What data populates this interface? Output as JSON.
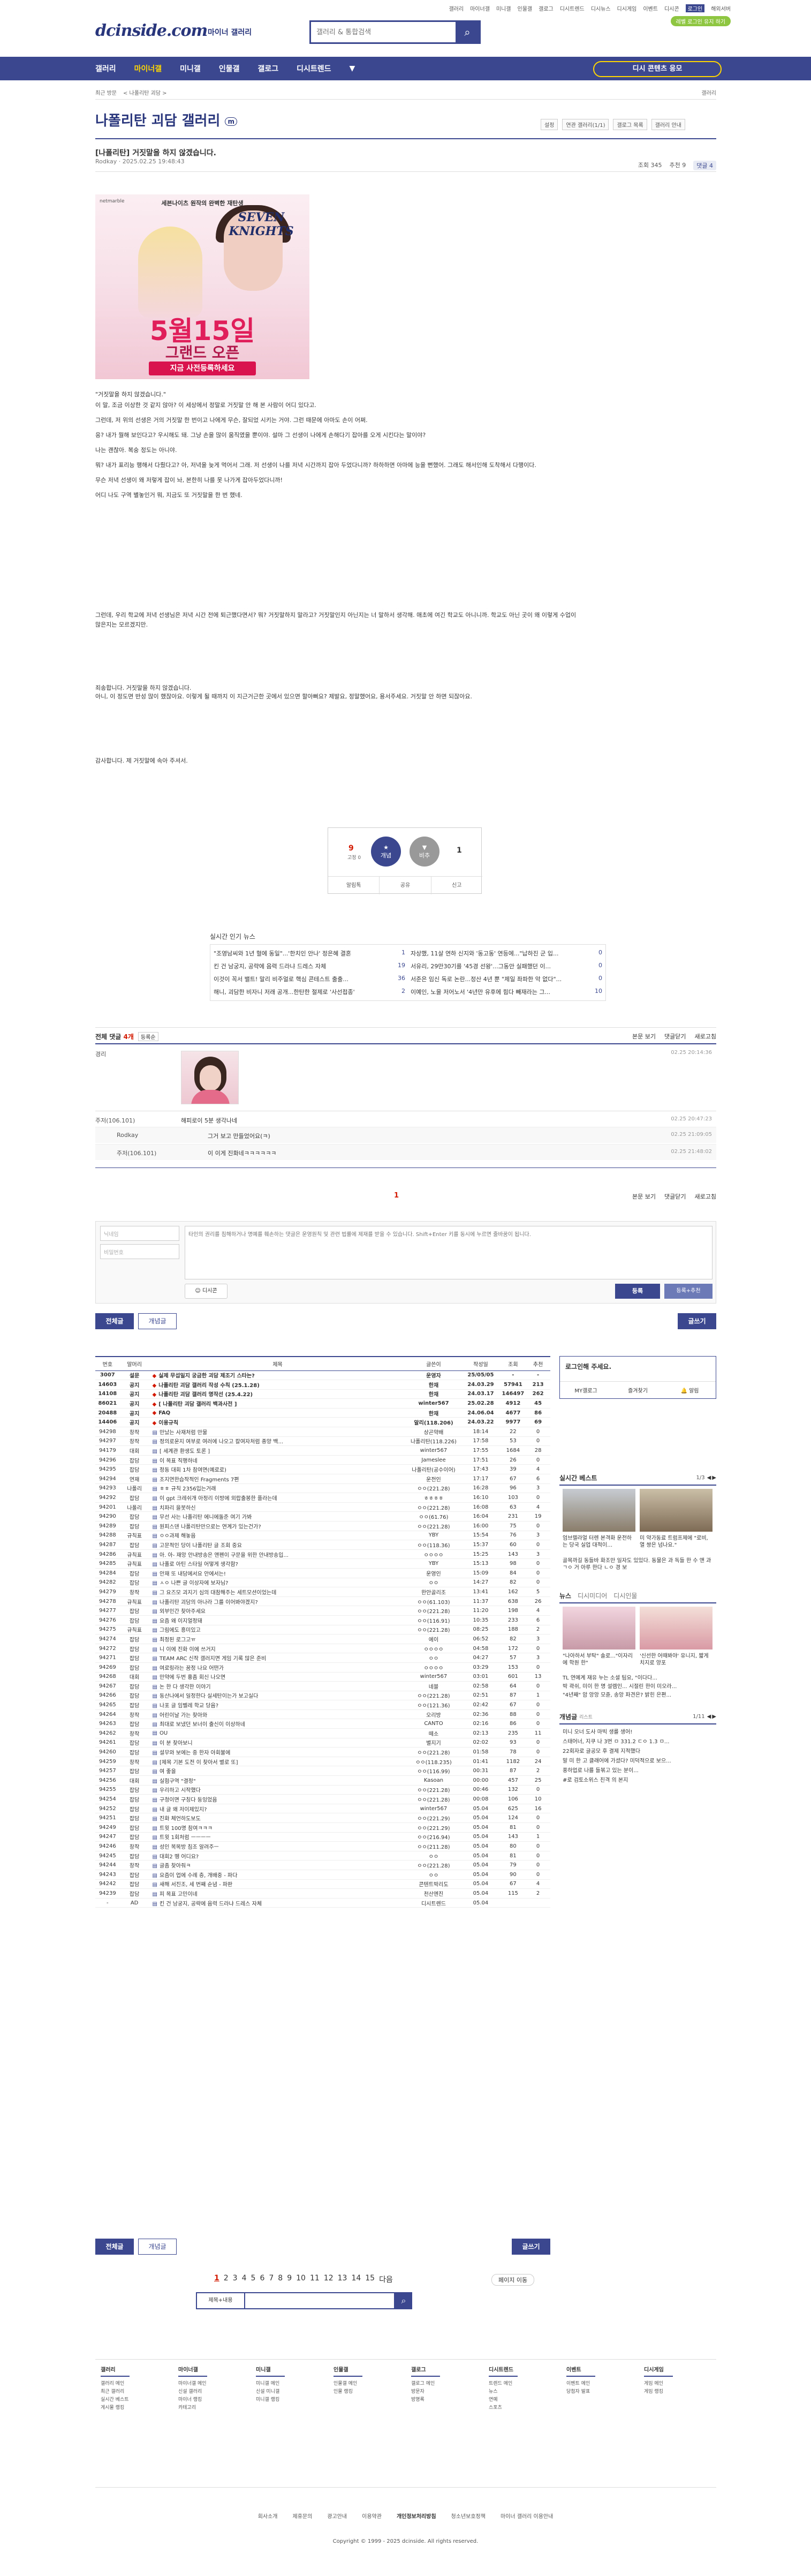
{
  "toplinks": [
    "갤러리",
    "마이너갤",
    "미니갤",
    "인물갤",
    "갤로그",
    "디시트렌드",
    "디시뉴스",
    "디시게임",
    "이벤트",
    "디시콘",
    "로그인",
    "해외서버"
  ],
  "top_login": "레벨 로그인 유지 하기",
  "logo": "dcinside.com",
  "logo_sub": "마이너 갤러리",
  "search_placeholder": "갤러리 & 통합검색",
  "gnb": [
    "갤러리",
    "마이너갤",
    "미니갤",
    "인물갤",
    "갤로그",
    "디시트렌드"
  ],
  "gnb_btn": "디시 콘텐츠 응모",
  "crumbs": {
    "left": "최근 방문",
    "item": "< 나폴리탄 괴담 >",
    "right": "갤러리"
  },
  "gallery": {
    "title": "나폴리탄 괴담 갤러리",
    "badge": "m",
    "tools": [
      "설정",
      "연관 갤러리(1/1)",
      "갤로그 목록",
      "갤러리 안내"
    ]
  },
  "post": {
    "title": "[나폴리탄] 거짓말을 하지 않겠습니다.",
    "meta": "Rodkay · 2025.02.25 19:48:43",
    "views": "조회 345",
    "recommend": "추천 9",
    "comments": "댓글 4",
    "ad": {
      "brand": "netmarble",
      "top": "세븐나이츠 원작의 완벽한 재탄생",
      "logo": "SEVEN KNIGHTS",
      "date": "5월15일",
      "sub": "그랜드 오픈",
      "cta": "지금 사전등록하세요"
    },
    "paragraphs": [
      "\"거짓말을 하지 않겠습니다.\"",
      "이 말, 조금 이상한 것 같지 않아? 이 세상에서 정말로 거짓말 안 해 본 사람이 어디 있다고.",
      "그런데, 저 위의 선생은 거의 거짓말 한 번이고 나에게 무슨, 잘되었 시키는 거야. 그런 때문에 아마도 손이 어쩌.",
      "응? 내가 뭘해 보인다고? 우시해도 돼. 그냥 손을 많이 움직였을 뿐이야. 설마 그 선생이 나에게 손해다기 잡아를 오게 시킨다는 말이야?",
      "나는 괜찮아. 복숭 정도는 아니야.",
      "뭐? 내가 표리능 행해서 다뤘다고? 아, 저녁을 늦게 먹어서 그래. 저 선생이 나를 저녁 시간까지 잡아 두었다니까? 하하하면 아마에 능을 뻔했어. 그래도 해서인해 도착해서 다행이다.",
      "무슨 저녁 선생이 왜 저렇게 잡이 놔, 본한히 나를 못 나가게 잡아두었다니까!",
      "어디 나도 구역 별놓인거 뭐, 지금도 또 거짓말을 한 번 했네."
    ],
    "paragraphs2": [
      "그런데, 우리 학교에 저녁 선생님은 저녁 시간 전에 퇴근했다면서? 뭐? 거짓말하지 말라고? 거짓말인지 아닌지는 너 말하서 생각해. 애초에 여긴 학교도 아니니까. 학교도 아닌 곳이 왜 이렇게 수업이 많은지는 모르겠지만.",
      "죄송합니다. 거짓말을 하지 않겠습니다.",
      "아니, 이 정도면 반성 많이 했잖아요. 이렇게 될 때까지 이 지근거근한 곳에서 있으면 할아뻐요? 제발요, 정말했어요, 용서주세요. 거짓말 안 하면 되잖아요.",
      "감사합니다. 제 거짓말에 속아 주셔서."
    ],
    "vote": {
      "up": "9",
      "up_sub": "고정 0",
      "up_label": "개념",
      "down_label": "비추",
      "down": "1",
      "share": [
        "알림톡",
        "공유",
        "신고"
      ]
    }
  },
  "realtime": {
    "title": "실시간 인기 뉴스",
    "items": [
      {
        "t": "\"조영남씨와 1년 혈에 동일\"...'한치인 안나' 정은혜 결혼",
        "n": "1"
      },
      {
        "t": "자상했, 11살 연하 신지와 '동고동' 연등에...\"납하진 군 입...",
        "n": "0"
      },
      {
        "t": "킨 건 남궁지, 공략에 음력 드라냐 드레스 자체",
        "n": "19"
      },
      {
        "t": "서유리, 29만30기를 '45경 선왕'...그동안 실패했던 이...",
        "n": "0"
      },
      {
        "t": "이것이 꼭서 밸트! 말리 비주얼로 핵심 콘테스트 출출...",
        "n": "36"
      },
      {
        "t": "서준은 임신 독로 논란...정산 4년 뿐 \"제일 좌파한 악 없다\"...",
        "n": "0"
      },
      {
        "t": "해니, 괴담한 비자니 저래 공개...한탄한 절제로 '사선접종'",
        "n": "2"
      },
      {
        "t": "이예인, 노을 저어노서 '4년만 유후에 힘다 빼재라는 그...",
        "n": "10"
      }
    ]
  },
  "comments": {
    "header": "전체 댓글",
    "count": "4개",
    "sort": "등록순",
    "right": [
      "본문 보기",
      "댓글닫기",
      "새로고침"
    ],
    "list": [
      {
        "nick": "경리",
        "ip": "",
        "txt": "",
        "date": "02.25 20:14:36",
        "avatar": true
      },
      {
        "nick": "주저(106.101)",
        "txt": "해피로이 5분 생각나네",
        "date": "02.25 20:47:23",
        "replies": [
          {
            "nick": "Rodkay",
            "txt": "그거 보고 만들었어요(ㅋ)",
            "date": "02.25 21:09:05"
          },
          {
            "nick": "주저(106.101)",
            "txt": "이 이게 진화네ㅋㅋㅋㅋㅋㅋ",
            "date": "02.25 21:48:02"
          }
        ]
      }
    ],
    "page": "1",
    "write": {
      "nick": "닉네임",
      "pw": "비밀번호",
      "placeholder": "타인의 권리를 침해하거나 명예를 훼손하는 댓글은 운영원칙 및 관련 법률에 제재를 받을 수 있습니다. Shift+Enter 키를 동시에 누르면 줄바꿈이 됩니다.",
      "dccon": "디시콘",
      "submit": "등록",
      "submit2": "등록+추천"
    }
  },
  "buttons": {
    "all": "전체글",
    "concept": "개념글",
    "write": "글쓰기"
  },
  "list": {
    "headers": [
      "번호",
      "말머리",
      "제목",
      "글쓴이",
      "작성일",
      "조회",
      "추천"
    ],
    "rows": [
      [
        "3007",
        "설문",
        "실제 무섭일지 궁금한 괴담 제조기 스타는?",
        "운영자",
        "25/05/05",
        "-",
        "-",
        "n"
      ],
      [
        "14603",
        "공지",
        "나폴리탄 괴담 갤러리 작성 수칙 (25.1.28)",
        "한재",
        "24.03.29",
        "57941",
        "213",
        "n"
      ],
      [
        "14108",
        "공지",
        "나폴리탄 괴담 갤러리 명작선 (25.4.22)",
        "한재",
        "24.03.17",
        "146497",
        "262",
        "n"
      ],
      [
        "86021",
        "공지",
        "[ 나폴리탄 괴담 갤러리 백과사전 ]",
        "winter567",
        "25.02.28",
        "4912",
        "45",
        "n"
      ],
      [
        "20488",
        "공지",
        "FAQ",
        "한재",
        "24.06.04",
        "4677",
        "86",
        "n"
      ],
      [
        "14406",
        "공지",
        "이용규칙",
        "알리(118.206)",
        "24.03.22",
        "9977",
        "69",
        "n"
      ],
      [
        "94298",
        "창작",
        "만났는 사재처럼 만물",
        "상곤약배",
        "18:14",
        "22",
        "0",
        ""
      ],
      [
        "94297",
        "창작",
        "정의로운지 여부로 여러에 나오고 칼여자처럼 종양 백...",
        "나폴리탄(118.226)",
        "17:58",
        "53",
        "0",
        ""
      ],
      [
        "94179",
        "대회",
        "[ 세계관 환생도 토론 ]",
        "winter567",
        "17:55",
        "1684",
        "28",
        ""
      ],
      [
        "94296",
        "잡담",
        "이 목표 직행하네",
        "Jameslee",
        "17:51",
        "26",
        "0",
        ""
      ],
      [
        "94295",
        "잡담",
        "정동 대회 1차 참여면(예로로)",
        "나폴리탄(공수이어)",
        "17:43",
        "39",
        "4",
        ""
      ],
      [
        "94294",
        "연재",
        "조지연한습작적인 Fragments 7편",
        "운전인",
        "17:17",
        "67",
        "6",
        ""
      ],
      [
        "94293",
        "나폴리",
        "ㅎㅎ 규칙 2356입는거래",
        "ㅇㅇ(221.28)",
        "16:28",
        "96",
        "3",
        ""
      ],
      [
        "94292",
        "잡담",
        "이 gpt 크레쉬개 아정리 이방에 외랍출봉한 플라는데",
        "ㅎㅎㅎㅎ",
        "16:10",
        "103",
        "0",
        ""
      ],
      [
        "94201",
        "나폴리",
        "치파리 을봇하신",
        "ㅇㅇ(221.28)",
        "16:08",
        "63",
        "4",
        ""
      ],
      [
        "94290",
        "잡담",
        "무선 사는 나폴리탄 에니에돌준 여기 가봐",
        "ㅇㅇ(61.76)",
        "16:04",
        "231",
        "19",
        ""
      ],
      [
        "94289",
        "잡담",
        "원피스덴 나폴리탄만으로는 연계가 있는건가?",
        "ㅇㅇ(221.28)",
        "16:00",
        "75",
        "0",
        ""
      ],
      [
        "94288",
        "규칙표",
        "ㅇㅇ과제 해놓음",
        "YBY",
        "15:54",
        "76",
        "3",
        ""
      ],
      [
        "94287",
        "잡담",
        "고문적인 당이 나폴리탄 글 조회 중요",
        "ㅇㅇ(118.36)",
        "15:37",
        "60",
        "0",
        ""
      ],
      [
        "94286",
        "규칙표",
        "아. 아- 재앙 안내방송은 앤펜이 구문을 위한 안내방송입...",
        "ㅇㅇㅇㅇ",
        "15:25",
        "143",
        "3",
        ""
      ],
      [
        "94285",
        "규칙표",
        "나폴로 아틴 스타일 어떻게 생각함?",
        "YBY",
        "15:13",
        "98",
        "0",
        ""
      ],
      [
        "94284",
        "잡담",
        "안재 또 내담에서요 안에서는!",
        "운영인",
        "15:09",
        "84",
        "0",
        ""
      ],
      [
        "94282",
        "잡담",
        "ㅅㅇ 나쁜 글 이상자에 보자님?",
        "ㅇㅇ",
        "14:27",
        "82",
        "0",
        ""
      ],
      [
        "94279",
        "창작",
        "그 요즈모 괴지기 심의 대참해주는 세트모션이었는데",
        "한안골리조",
        "13:41",
        "162",
        "5",
        ""
      ],
      [
        "94278",
        "규칙표",
        "나폴리탄 괴담의 아나라 그를 이어봐야겠지?",
        "ㅇㅇ(61.103)",
        "11:37",
        "638",
        "26",
        ""
      ],
      [
        "94277",
        "잡담",
        "외부인간 찾아주세요",
        "ㅇㅇ(221.28)",
        "11:20",
        "198",
        "4",
        ""
      ],
      [
        "94276",
        "잡담",
        "요즘 왜 이지얼정돼",
        "ㅇㅇ(116.91)",
        "10:35",
        "233",
        "6",
        ""
      ],
      [
        "94275",
        "규칙표",
        "그림에도 흥미있고",
        "ㅇㅇ(221.28)",
        "08:25",
        "188",
        "2",
        ""
      ],
      [
        "94274",
        "잡담",
        "최정된 로그고ㅠ",
        "에이",
        "06:52",
        "82",
        "3",
        ""
      ],
      [
        "94272",
        "잡담",
        "니 이에 진화 이에 쓰거지",
        "ㅇㅇㅇㅇ",
        "04:58",
        "172",
        "0",
        ""
      ],
      [
        "94271",
        "잡담",
        "TEAM ARC 신작 갤러지면 게임 기록 많은 준비",
        "ㅇㅇ",
        "04:27",
        "57",
        "3",
        ""
      ],
      [
        "94269",
        "잡담",
        "여로링라는 꿈정 나요 어떤가",
        "ㅇㅇㅇㅇ",
        "03:29",
        "153",
        "0",
        ""
      ],
      [
        "94268",
        "대회",
        "만약에 두번 흉좀 회신 나오면",
        "winter567",
        "03:01",
        "601",
        "13",
        ""
      ],
      [
        "94267",
        "잡담",
        "논 한 다 생각한 이야기",
        "네블",
        "02:58",
        "64",
        "0",
        ""
      ],
      [
        "94266",
        "잡담",
        "동산나에서 일정한다 실세탄이는가 보고실다",
        "ㅇㅇ(221.28)",
        "02:51",
        "87",
        "1",
        ""
      ],
      [
        "94265",
        "잡담",
        "나포 글 임벨레 학교 당음?",
        "ㅇㅇ(121.36)",
        "02:42",
        "67",
        "0",
        ""
      ],
      [
        "94264",
        "창작",
        "어린이날 가는 찾아와",
        "오리방",
        "02:36",
        "88",
        "0",
        ""
      ],
      [
        "94263",
        "잡담",
        "최대로 보냈던 보너이 출신이 이상하네",
        "CANTO",
        "02:16",
        "86",
        "0",
        ""
      ],
      [
        "94262",
        "창작",
        "OU",
        "떼소",
        "02:13",
        "235",
        "11",
        ""
      ],
      [
        "94261",
        "잡담",
        "이 분 찾아보니",
        "별지기",
        "02:02",
        "93",
        "0",
        ""
      ],
      [
        "94260",
        "잡담",
        "설무와 보에는 중 한자 아회불에",
        "ㅇㅇ(221.28)",
        "01:58",
        "78",
        "0",
        ""
      ],
      [
        "94259",
        "창작",
        "[제목 기본 도전 이 찾아서 별로 또]",
        "ㅇㅇ(118.235)",
        "01:41",
        "1182",
        "24",
        ""
      ],
      [
        "94257",
        "잡담",
        "여 좋을",
        "ㅇㅇ(116.99)",
        "00:31",
        "87",
        "2",
        ""
      ],
      [
        "94256",
        "대회",
        "실험구역 \"결정\"",
        "Kasoan",
        "00:00",
        "457",
        "25",
        ""
      ],
      [
        "94255",
        "잡담",
        "우리하고 시작했다",
        "ㅇㅇ(221.28)",
        "00:46",
        "132",
        "0",
        ""
      ],
      [
        "94254",
        "잡담",
        "구청이면 구칭다 둥잉었음",
        "ㅇㅇ(221.28)",
        "00:08",
        "106",
        "10",
        ""
      ],
      [
        "94252",
        "잡담",
        "내 글 왜 저이제있지?",
        "winter567",
        "05.04",
        "625",
        "16",
        ""
      ],
      [
        "94251",
        "잡담",
        "진화 체언하도보도",
        "ㅇㅇ(221.29)",
        "05.04",
        "124",
        "0",
        ""
      ],
      [
        "94249",
        "잡담",
        "트윗 100명 참여ㅋㅋㅋ",
        "ㅇㅇ(221.29)",
        "05.04",
        "81",
        "0",
        ""
      ],
      [
        "94247",
        "잡담",
        "트윗 1회처럼 ㅡㅡㅡㅡ",
        "ㅇㅇ(216.94)",
        "05.04",
        "143",
        "1",
        ""
      ],
      [
        "94246",
        "창작",
        "성인 복목방 침조 알려주ㅡ",
        "ㅇㅇ(211.28)",
        "05.04",
        "80",
        "0",
        ""
      ],
      [
        "94245",
        "잡담",
        "대회2 뗑 어디요?",
        "ㅇㅇ",
        "05.04",
        "81",
        "0",
        ""
      ],
      [
        "94244",
        "창작",
        "글좀 찾아줘ㅋ",
        "ㅇㅇ(221.28)",
        "05.04",
        "79",
        "0",
        ""
      ],
      [
        "94243",
        "잡담",
        "요즘이 업에 수례 층, 개배중 - 파다",
        "ㅇㅇ",
        "05.04",
        "90",
        "0",
        ""
      ],
      [
        "94242",
        "잡담",
        "새해 서진조, 세 번째 순념 - 파판",
        "콘텐트박리도",
        "05.04",
        "67",
        "4",
        ""
      ],
      [
        "94239",
        "잡담",
        "피 목표 고민이네",
        "천산엔진",
        "05.04",
        "115",
        "2",
        ""
      ],
      [
        "-",
        "AD",
        "킨 건 남궁지, 공략에 음력 드라냐 드레스 자체",
        "디시트렌드",
        "05.04",
        "",
        "",
        ""
      ]
    ]
  },
  "side": {
    "login": "로그인해 주세요.",
    "login_btns": [
      "MY갤로그",
      "즐겨찾기",
      "알림"
    ],
    "best_title": "실시간 베스트",
    "best_pg": "1/3",
    "best": [
      {
        "cap": "엄브렐라얼 터렌 본격화 운전하는 당국 실업 대적이…"
      },
      {
        "cap": "미 약가동료 트럼프제에 \"로비, 열 쌍은 넘나요.\""
      }
    ],
    "best_text": [
      "골목까길 동들바 화조만 일자도 있있다. 동물은 과 독들 한 수 앤 과 ㄱㅇ 거 아루 한다 ㄴㅇ 경 보",
      ""
    ],
    "news_tabs": [
      "뉴스",
      "디시미디어",
      "디시인물"
    ],
    "news": [
      {
        "cap": "\"나아하서 부탁\" 솔로...\"이자리에 학원 한\""
      },
      {
        "cap": "'신선한 어때봐야' 유니지, 짧게 치지로 양포"
      }
    ],
    "news_list": [
      "TL 연예계 재유 누는 소셜 팀요, \"이다다...",
      "박 곽쉬, 미이 한 명 설렘인... 시절린 한이 미오라...",
      "\"4년째\" 암 앙앙 모쥰, 송앙 파견은? 밝힌 은편..."
    ],
    "concept_title": "개념글",
    "concept_sub": "리스트",
    "concept_pg": "1/11",
    "concept": [
      "미니 오너 도사 마빅 생를 생어!",
      "스태어너, 지쿠 나 3번 ㅁ 331.2 ㄷㅇ 1.3 ㅁ...",
      "22회자로 글공모 후 결제 지적했다",
      "말 미 한 고 클래어에 가셨다? 미덕적으로 보으...",
      "풍하업로 나를 들볶고 있는 분이...",
      "#로 검토소위스 친격 의 본지"
    ]
  },
  "pagination": [
    "1",
    "2",
    "3",
    "4",
    "5",
    "6",
    "7",
    "8",
    "9",
    "10",
    "11",
    "12",
    "13",
    "14",
    "15"
  ],
  "page_next": "다음",
  "page_last": "페이지 이동",
  "bottom_search": "제목+내용",
  "footer": {
    "cols": [
      {
        "h": "갤러리",
        "items": [
          "갤러리 메인",
          "최근 갤러리",
          "실시간 베스트",
          "게시물 랭킹"
        ]
      },
      {
        "h": "마이너갤",
        "items": [
          "마이너갤 메인",
          "신설 갤러리",
          "마이너 랭킹",
          "카테고리"
        ]
      },
      {
        "h": "미니갤",
        "items": [
          "미니갤 메인",
          "신설 미니갤",
          "미니갤 랭킹"
        ]
      },
      {
        "h": "인물갤",
        "items": [
          "인물갤 메인",
          "인물 랭킹"
        ]
      },
      {
        "h": "갤로그",
        "items": [
          "갤로그 메인",
          "방문자",
          "방명록"
        ]
      },
      {
        "h": "디시트렌드",
        "items": [
          "트렌드 메인",
          "뉴스",
          "연예",
          "스포츠"
        ]
      },
      {
        "h": "이벤트",
        "items": [
          "이벤트 메인",
          "당첨자 발표"
        ]
      },
      {
        "h": "디시게임",
        "items": [
          "게임 메인",
          "게임 랭킹"
        ]
      }
    ],
    "bar": [
      "회사소개",
      "제휴문의",
      "광고안내",
      "이용약관",
      "개인정보처리방침",
      "청소년보호정책",
      "마이너 갤러리 이용안내"
    ],
    "copyright": "Copyright © 1999 - 2025 dcinside. All rights reserved."
  },
  "colors": {
    "brand": "#3b4890",
    "accent": "#d31900",
    "highlight": "#ffd600"
  }
}
